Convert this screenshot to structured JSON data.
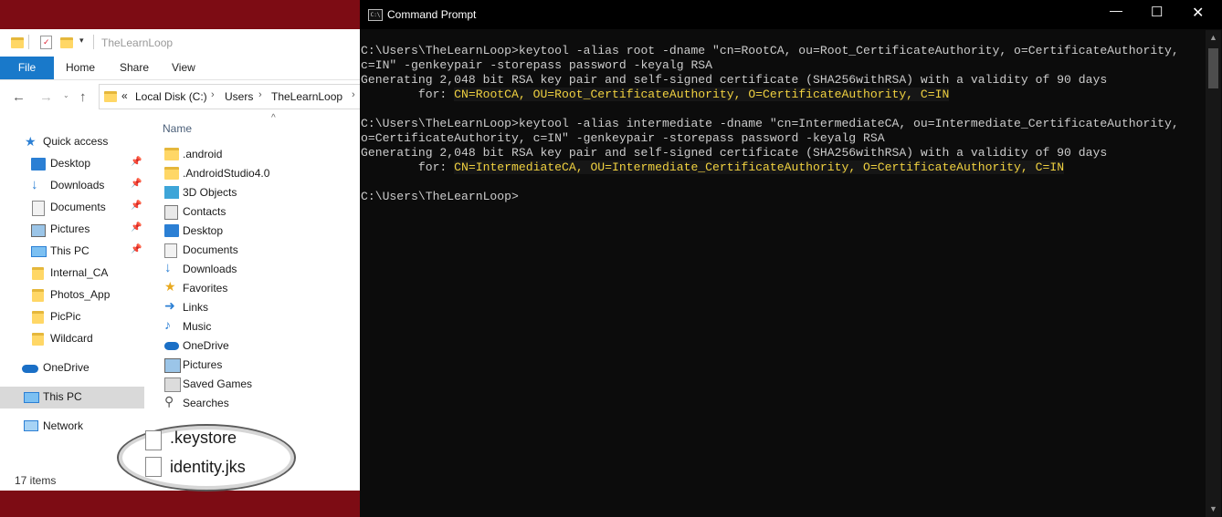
{
  "explorer": {
    "title": "TheLearnLoop",
    "ribbon": {
      "file": "File",
      "home": "Home",
      "share": "Share",
      "view": "View"
    },
    "address": {
      "overflow": "«",
      "crumbs": [
        "Local Disk (C:)",
        "Users",
        "TheLearnLoop"
      ],
      "sep": "›"
    },
    "nav": {
      "quick_access": "Quick access",
      "pinned": [
        "Desktop",
        "Downloads",
        "Documents",
        "Pictures",
        "This PC"
      ],
      "folders": [
        "Internal_CA",
        "Photos_App",
        "PicPic",
        "Wildcard"
      ],
      "onedrive": "OneDrive",
      "this_pc": "This PC",
      "network": "Network"
    },
    "column_name": "Name",
    "files": [
      ".android",
      ".AndroidStudio4.0",
      "3D Objects",
      "Contacts",
      "Desktop",
      "Documents",
      "Downloads",
      "Favorites",
      "Links",
      "Music",
      "OneDrive",
      "Pictures",
      "Saved Games",
      "Searches"
    ],
    "highlighted_files": [
      ".keystore",
      "identity.jks"
    ],
    "status": "17 items"
  },
  "cmd": {
    "title": "Command Prompt",
    "lines": [
      {
        "text": "C:\\Users\\TheLearnLoop>keytool -alias root -dname \"cn=RootCA, ou=Root_CertificateAuthority, o=CertificateAuthority,",
        "hl": ""
      },
      {
        "text": "c=IN\" -genkeypair -storepass password -keyalg RSA",
        "hl": ""
      },
      {
        "text": "Generating 2,048 bit RSA key pair and self-signed certificate (SHA256withRSA) with a validity of 90 days",
        "hl": ""
      },
      {
        "text": "        for: ",
        "hl": "CN=RootCA, OU=Root_CertificateAuthority, O=CertificateAuthority, C=IN"
      },
      {
        "text": "",
        "hl": ""
      },
      {
        "text": "C:\\Users\\TheLearnLoop>keytool -alias intermediate -dname \"cn=IntermediateCA, ou=Intermediate_CertificateAuthority,",
        "hl": ""
      },
      {
        "text": "o=CertificateAuthority, c=IN\" -genkeypair -storepass password -keyalg RSA",
        "hl": ""
      },
      {
        "text": "Generating 2,048 bit RSA key pair and self-signed certificate (SHA256withRSA) with a validity of 90 days",
        "hl": ""
      },
      {
        "text": "        for: ",
        "hl": "CN=IntermediateCA, OU=Intermediate_CertificateAuthority, O=CertificateAuthority, C=IN"
      },
      {
        "text": "",
        "hl": ""
      },
      {
        "text": "C:\\Users\\TheLearnLoop>",
        "hl": ""
      }
    ]
  }
}
